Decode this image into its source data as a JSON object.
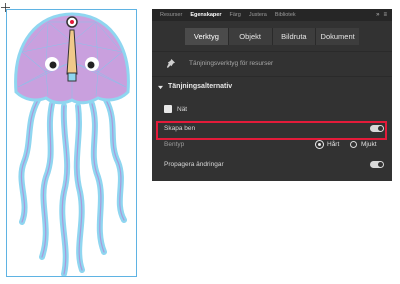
{
  "panel": {
    "tabs": [
      "Resurser",
      "Egenskaper",
      "Färg",
      "Justera",
      "Bibliotek"
    ],
    "active_tab": "Egenskaper",
    "modes": [
      "Verktyg",
      "Objekt",
      "Bildruta",
      "Dokument"
    ],
    "active_mode": "Verktyg",
    "tool_header": "Tänjningsverktyg för resurser",
    "section_title": "Tänjningsalternativ",
    "options": {
      "mesh_label": "Nät",
      "create_bones_label": "Skapa ben",
      "bone_type_label": "Bentyp",
      "bone_type_hard": "Hårt",
      "bone_type_soft": "Mjukt",
      "propagate_label": "Propagera ändringar"
    }
  },
  "colors": {
    "panel_bg": "#323232",
    "highlight": "#e31b3a",
    "selection": "#5fb3e3",
    "jelly_bell": "#c9a0de",
    "tentacle": "#8fd6f0"
  }
}
